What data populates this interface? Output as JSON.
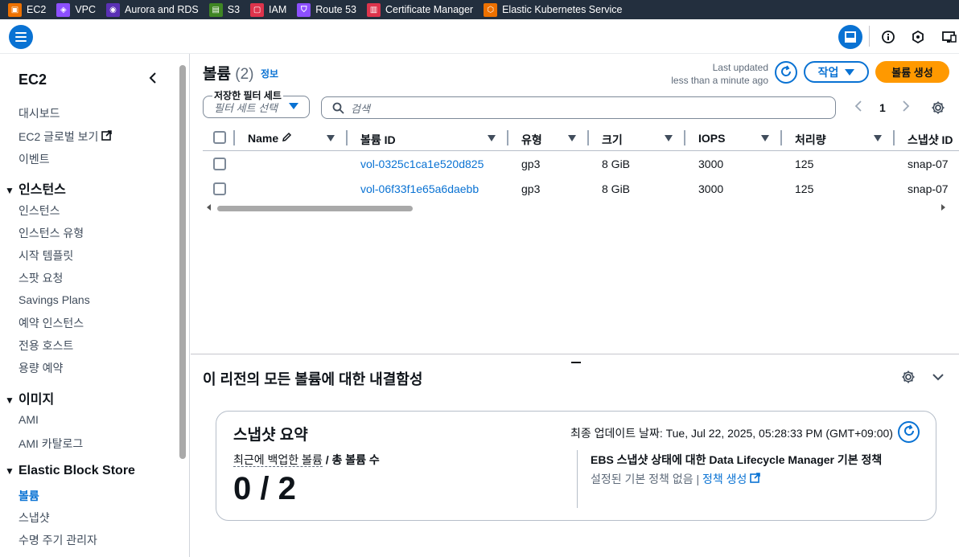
{
  "favorites": [
    {
      "label": "EC2",
      "icon": "ec2-icon",
      "color": "#ed7100"
    },
    {
      "label": "VPC",
      "icon": "vpc-icon",
      "color": "#8c4fff"
    },
    {
      "label": "Aurora and RDS",
      "icon": "rds-icon",
      "color": "#c925d1"
    },
    {
      "label": "S3",
      "icon": "s3-icon",
      "color": "#7aa116"
    },
    {
      "label": "IAM",
      "icon": "iam-icon",
      "color": "#dd344c"
    },
    {
      "label": "Route 53",
      "icon": "route53-icon",
      "color": "#8c4fff"
    },
    {
      "label": "Certificate Manager",
      "icon": "acm-icon",
      "color": "#dd344c"
    },
    {
      "label": "Elastic Kubernetes Service",
      "icon": "eks-icon",
      "color": "#ed7100"
    }
  ],
  "sidebar": {
    "title": "EC2",
    "items": {
      "dashboard": "대시보드",
      "global_view": "EC2 글로벌 보기",
      "events": "이벤트",
      "sec_instances": "인스턴스",
      "instances": "인스턴스",
      "instance_types": "인스턴스 유형",
      "launch_templates": "시작 템플릿",
      "spot_requests": "스팟 요청",
      "savings_plans": "Savings Plans",
      "reserved_instances": "예약 인스턴스",
      "dedicated_hosts": "전용 호스트",
      "capacity_reservations": "용량 예약",
      "sec_images": "이미지",
      "ami": "AMI",
      "ami_catalog": "AMI 카탈로그",
      "sec_ebs": "Elastic Block Store",
      "volumes": "볼륨",
      "snapshots": "스냅샷",
      "lifecycle_manager": "수명 주기 관리자"
    }
  },
  "main": {
    "title": "볼륨",
    "count": "(2)",
    "info": "정보",
    "last_updated_1": "Last updated",
    "last_updated_2": "less than a minute ago",
    "actions_label": "작업",
    "create_label": "볼륨 생성",
    "filter_set_label": "저장한 필터 세트",
    "filter_set_placeholder": "필터 세트 선택",
    "search_placeholder": "검색",
    "page_number": "1"
  },
  "table": {
    "columns": [
      "Name",
      "볼륨 ID",
      "유형",
      "크기",
      "IOPS",
      "처리량",
      "스냅샷 ID"
    ],
    "rows": [
      {
        "name": "",
        "volume_id": "vol-0325c1ca1e520d825",
        "type": "gp3",
        "size": "8 GiB",
        "iops": "3000",
        "throughput": "125",
        "snapshot": "snap-07"
      },
      {
        "name": "",
        "volume_id": "vol-06f33f1e65a6daebb",
        "type": "gp3",
        "size": "8 GiB",
        "iops": "3000",
        "throughput": "125",
        "snapshot": "snap-07"
      }
    ]
  },
  "split_panel": {
    "title": "이 리전의 모든 볼륨에 대한 내결함성",
    "card_title": "스냅샷 요약",
    "last_update": "최종 업데이트 날짜: Tue, Jul 22, 2025, 05:28:33 PM (GMT+09:00)",
    "kpi_label_recent": "최근에 백업한 볼륨",
    "kpi_label_rest": " / 총 볼륨 수",
    "kpi_value": "0 / 2",
    "policy_title": "EBS 스냅샷 상태에 대한 Data Lifecycle Manager 기본 정책",
    "policy_text": "설정된 기본 정책 없음 | ",
    "policy_link": "정책 생성"
  },
  "colors": {
    "accent": "#0972d3",
    "primary_button": "#ff9900",
    "nav_bar": "#232f3e"
  }
}
